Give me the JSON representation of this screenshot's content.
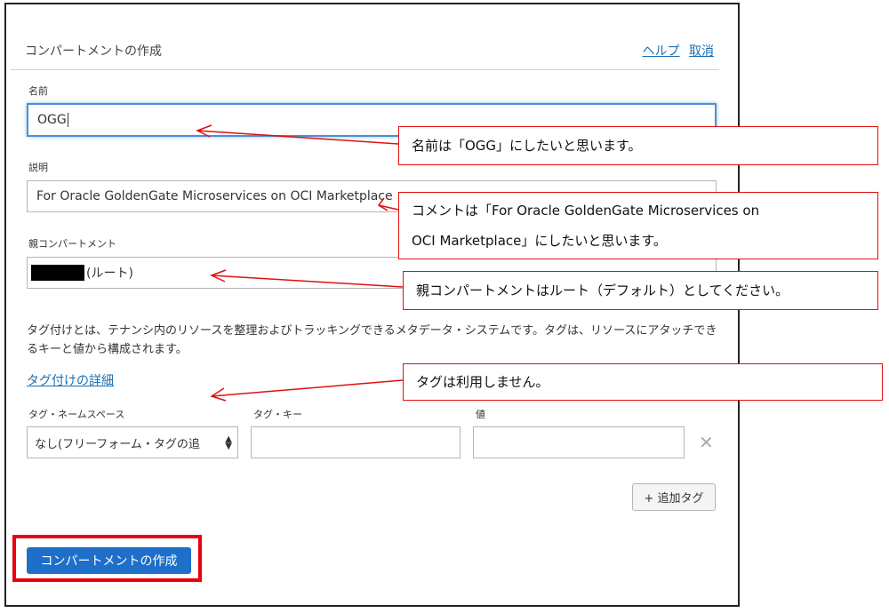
{
  "header": {
    "title": "コンパートメントの作成",
    "help_link": "ヘルプ",
    "cancel_link": "取消"
  },
  "form": {
    "name_label": "名前",
    "name_value": "OGG",
    "description_label": "説明",
    "description_value": "For Oracle GoldenGate Microservices on OCI Marketplace",
    "parent_label": "親コンパートメント",
    "parent_value": "(ルート)",
    "tag_description": "タグ付けとは、テナンシ内のリソースを整理およびトラッキングできるメタデータ・システムです。タグは、リソースにアタッチできるキーと値から構成されます。",
    "tag_details_link": "タグ付けの詳細",
    "tag_namespace_label": "タグ・ネームスペース",
    "tag_namespace_value": "なし(フリーフォーム・タグの追",
    "tag_key_label": "タグ・キー",
    "tag_value_label": "値",
    "add_tag_button": "+ 追加タグ",
    "create_button": "コンパートメントの作成"
  },
  "callouts": {
    "name": "名前は「OGG」にしたいと思います。",
    "comment_line1": "コメントは「For Oracle GoldenGate Microservices on",
    "comment_line2": "OCI Marketplace」にしたいと思います。",
    "parent": "親コンパートメントはルート（デフォルト）としてください。",
    "tag": "タグは利用しません。"
  },
  "colors": {
    "accent": "#1e6fc9",
    "link": "#1a6fb5",
    "callout_border": "#e01010"
  },
  "icons": {
    "remove_tag": "close-icon",
    "select_arrow": "chevron-updown-icon"
  }
}
